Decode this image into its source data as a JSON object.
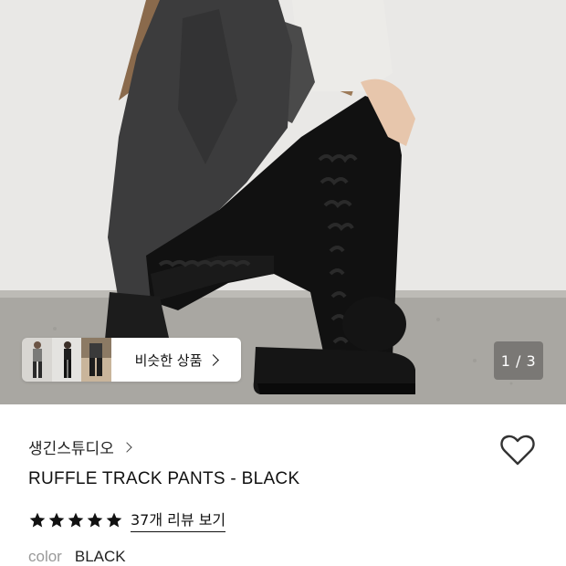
{
  "gallery": {
    "current_page": "1",
    "total_pages": "3",
    "page_separator": " / ",
    "similar_products_label": "비슷한 상품"
  },
  "product": {
    "brand": "생긴스튜디오",
    "title": "RUFFLE TRACK PANTS - BLACK",
    "rating_stars": 5,
    "review_link": "37개 리뷰 보기",
    "option_label": "color",
    "option_value": "BLACK"
  },
  "colors": {
    "star": "#111111",
    "heart_outline": "#333333",
    "muted_text": "#999999"
  },
  "icons": {
    "wishlist": "heart-outline-icon",
    "brand_chevron": "chevron-right-icon",
    "rating": "star-icon"
  }
}
